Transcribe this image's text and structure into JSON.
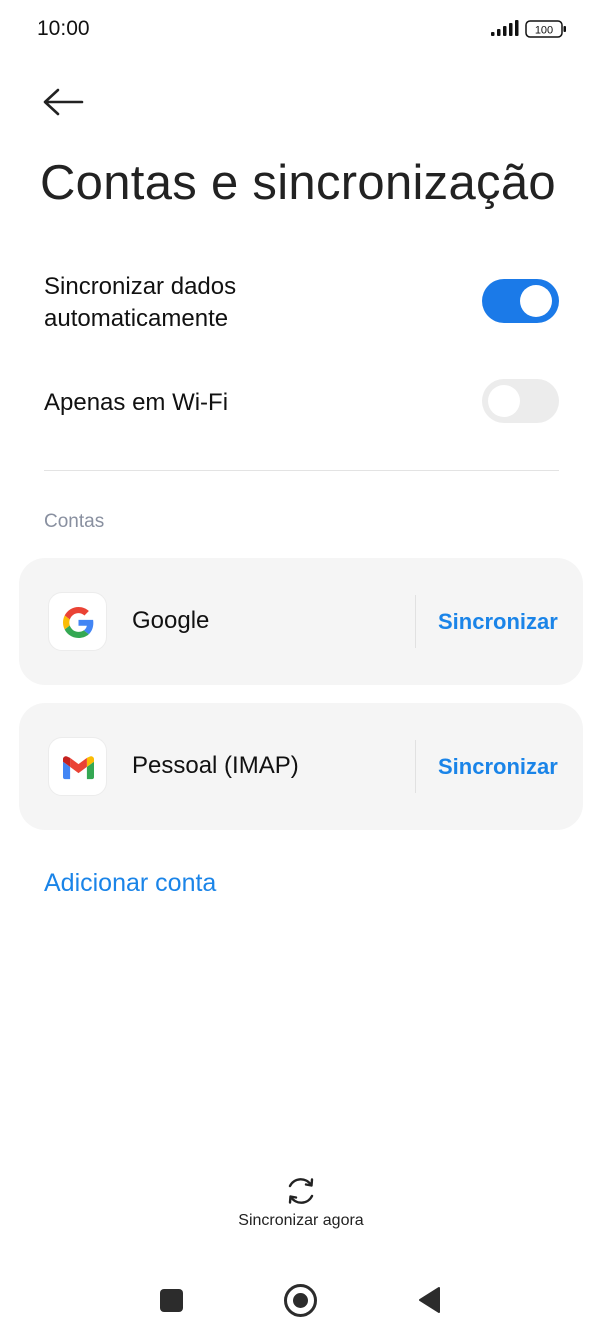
{
  "status_bar": {
    "time": "10:00",
    "battery": "100"
  },
  "header": {
    "title": "Contas e sincronização"
  },
  "settings": {
    "auto_sync": {
      "label": "Sincronizar dados automaticamente",
      "enabled": true
    },
    "wifi_only": {
      "label": "Apenas em Wi-Fi",
      "enabled": false
    }
  },
  "accounts": {
    "section_label": "Contas",
    "items": [
      {
        "name": "Google",
        "icon": "google-icon",
        "action": "Sincronizar"
      },
      {
        "name": "Pessoal (IMAP)",
        "icon": "gmail-icon",
        "action": "Sincronizar"
      }
    ],
    "add_label": "Adicionar conta"
  },
  "footer": {
    "sync_now_label": "Sincronizar agora"
  },
  "colors": {
    "accent": "#1a84e8",
    "toggle_on": "#1b7ae8",
    "toggle_off": "#ececec",
    "card_bg": "#f5f5f5"
  }
}
